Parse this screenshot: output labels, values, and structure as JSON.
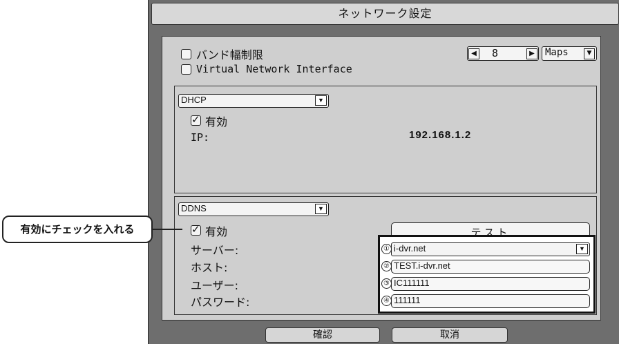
{
  "window": {
    "title": "ネットワーク設定"
  },
  "options": {
    "bandwidth_limit_label": "バンド幅制限",
    "vni_label": "Virtual Network Interface",
    "bandwidth_value": "8",
    "bandwidth_unit": "Maps"
  },
  "dhcp": {
    "mode": "DHCP",
    "enabled_label": "有効",
    "ip_label": "IP:",
    "ip_value": "192.168.1.2"
  },
  "ddns": {
    "mode": "DDNS",
    "enabled_label": "有効",
    "test_button": "テスト",
    "server_label": "サーバー:",
    "host_label": "ホスト:",
    "user_label": "ユーザー:",
    "password_label": "パスワード:",
    "server_value": "i-dvr.net",
    "host_value": "TEST.i-dvr.net",
    "user_value": "IC111111",
    "password_value": "111111",
    "markers": [
      "①",
      "②",
      "③",
      "④"
    ]
  },
  "callout": {
    "text": "有効にチェックを入れる"
  },
  "footer": {
    "confirm": "確認",
    "cancel": "取消"
  }
}
